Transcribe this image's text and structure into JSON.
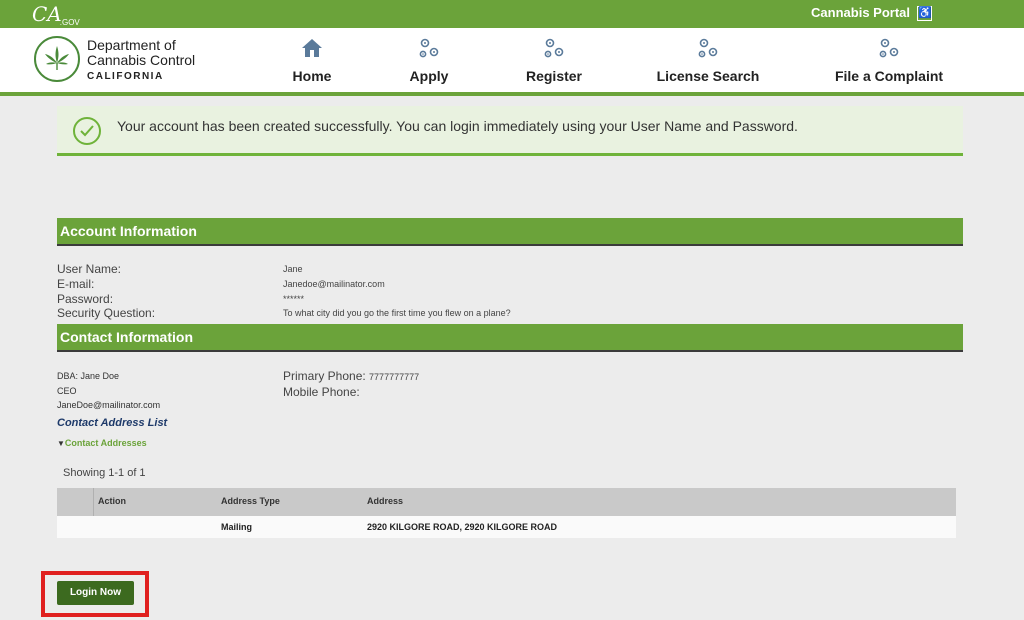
{
  "topbar": {
    "ca_logo": "CA",
    "ca_gov": ".GOV",
    "portal": "Cannabis Portal",
    "accessibility_icon": "wheelchair-icon"
  },
  "header": {
    "logo_line1": "Department of",
    "logo_line2": "Cannabis Control",
    "logo_line3": "CALIFORNIA",
    "nav": [
      {
        "label": "Home",
        "icon": "home-icon"
      },
      {
        "label": "Apply",
        "icon": "gears-icon"
      },
      {
        "label": "Register",
        "icon": "gears-icon"
      },
      {
        "label": "License Search",
        "icon": "gears-icon"
      },
      {
        "label": "File a Complaint",
        "icon": "gears-icon"
      }
    ]
  },
  "banner": {
    "message": "Your account has been created successfully.  You can login immediately using your User Name and Password."
  },
  "account": {
    "title": "Account Information",
    "fields": [
      {
        "label": "User Name:",
        "value": "Jane"
      },
      {
        "label": "E-mail:",
        "value": "Janedoe@mailinator.com"
      },
      {
        "label": "Password:",
        "value": "******"
      },
      {
        "label": "Security Question:",
        "value": "To what city did you go the first time you flew on a plane?"
      }
    ]
  },
  "contact": {
    "title": "Contact Information",
    "dba": "DBA: Jane Doe",
    "role": "CEO",
    "email": "JaneDoe@mailinator.com",
    "primary_phone_label": "Primary Phone:",
    "primary_phone": "7777777777",
    "mobile_phone_label": "Mobile Phone:",
    "mobile_phone": "",
    "address_list_title": "Contact Address List",
    "addresses_toggle": "Contact Addresses",
    "showing": "Showing 1-1 of 1",
    "table": {
      "headers": [
        "Action",
        "Address Type",
        "Address"
      ],
      "rows": [
        {
          "action": "",
          "type": "Mailing",
          "address": "2920 KILGORE ROAD, 2920 KILGORE ROAD"
        }
      ]
    }
  },
  "login_button": "Login Now",
  "colors": {
    "brand_green": "#6ba33a",
    "dark_green": "#3c6a1f",
    "highlight_red": "#e0201f"
  }
}
